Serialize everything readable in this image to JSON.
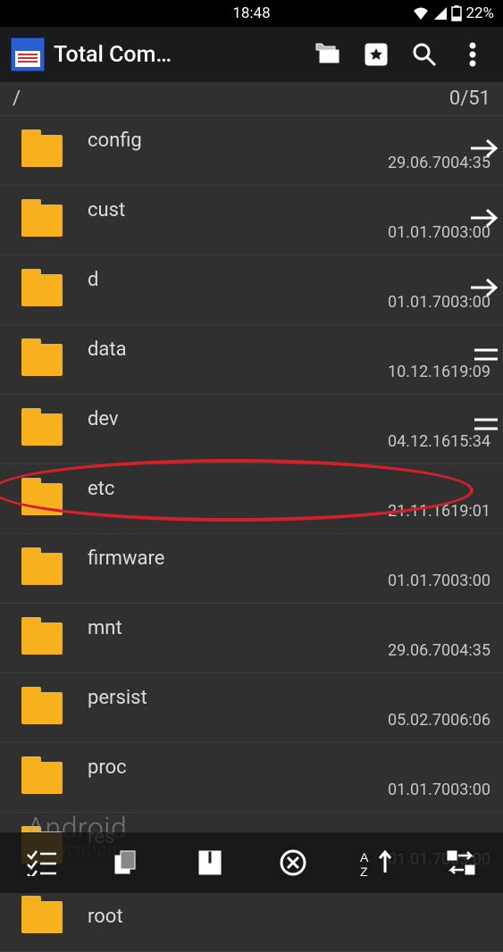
{
  "status": {
    "time": "18:48",
    "battery": "22%"
  },
  "header": {
    "title": "Total Com…"
  },
  "path": {
    "current": "/",
    "counter": "0/51"
  },
  "files": [
    {
      "name": "config",
      "type": "<dir>",
      "date": "29.06.70",
      "time": "04:35",
      "side": "arrow"
    },
    {
      "name": "cust",
      "type": "<dir>",
      "date": "01.01.70",
      "time": "03:00",
      "side": "arrow"
    },
    {
      "name": "d",
      "type": "<dir>",
      "date": "01.01.70",
      "time": "03:00",
      "side": "arrow"
    },
    {
      "name": "data",
      "type": "<dir>",
      "date": "10.12.16",
      "time": "19:09",
      "side": "lines"
    },
    {
      "name": "dev",
      "type": "<dir>",
      "date": "04.12.16",
      "time": "15:34",
      "side": "lines"
    },
    {
      "name": "etc",
      "type": "<dir>",
      "date": "21.11.16",
      "time": "19:01",
      "side": "",
      "highlight": true
    },
    {
      "name": "firmware",
      "type": "<dir>",
      "date": "01.01.70",
      "time": "03:00",
      "side": ""
    },
    {
      "name": "mnt",
      "type": "<dir>",
      "date": "29.06.70",
      "time": "04:35",
      "side": ""
    },
    {
      "name": "persist",
      "type": "<dir>",
      "date": "05.02.70",
      "time": "06:06",
      "side": ""
    },
    {
      "name": "proc",
      "type": "<dir>",
      "date": "01.01.70",
      "time": "03:00",
      "side": ""
    },
    {
      "name": "res",
      "type": "<dir>",
      "date": "01.01.70",
      "time": "03:00",
      "side": ""
    },
    {
      "name": "root",
      "type": "",
      "date": "",
      "time": "",
      "side": ""
    }
  ],
  "watermark": {
    "brand": "Android",
    "sub": "applications"
  }
}
